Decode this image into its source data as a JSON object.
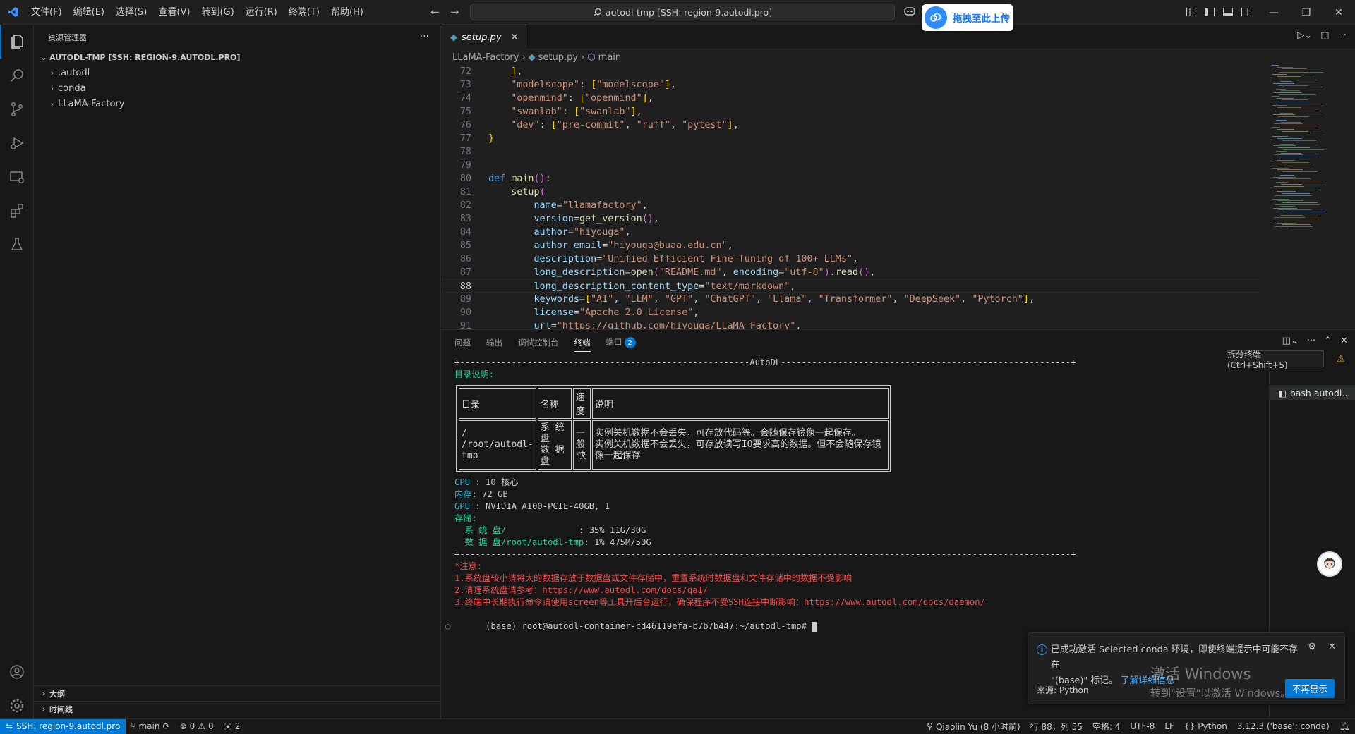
{
  "titlebar": {
    "menus": [
      "文件(F)",
      "编辑(E)",
      "选择(S)",
      "查看(V)",
      "转到(G)",
      "运行(R)",
      "终端(T)",
      "帮助(H)"
    ],
    "command_center": "autodl-tmp [SSH: region-9.autodl.pro]",
    "upload_label": "拖拽至此上传"
  },
  "sidebar": {
    "title": "资源管理器",
    "root": "AUTODL-TMP [SSH: REGION-9.AUTODL.PRO]",
    "items": [
      ".autodl",
      "conda",
      "LLaMA-Factory"
    ],
    "outline": "大纲",
    "timeline": "时间线"
  },
  "editor": {
    "tab": "setup.py",
    "breadcrumb": [
      "LLaMA-Factory",
      "setup.py",
      "main"
    ],
    "current_line": "88",
    "lines": [
      {
        "n": "72",
        "t": "    ],"
      },
      {
        "n": "73",
        "t": "    \"modelscope\": [\"modelscope\"],"
      },
      {
        "n": "74",
        "t": "    \"openmind\": [\"openmind\"],"
      },
      {
        "n": "75",
        "t": "    \"swanlab\": [\"swanlab\"],"
      },
      {
        "n": "76",
        "t": "    \"dev\": [\"pre-commit\", \"ruff\", \"pytest\"],"
      },
      {
        "n": "77",
        "t": "}"
      },
      {
        "n": "78",
        "t": ""
      },
      {
        "n": "79",
        "t": ""
      },
      {
        "n": "80",
        "t": "def main():"
      },
      {
        "n": "81",
        "t": "    setup("
      },
      {
        "n": "82",
        "t": "        name=\"llamafactory\","
      },
      {
        "n": "83",
        "t": "        version=get_version(),"
      },
      {
        "n": "84",
        "t": "        author=\"hiyouga\","
      },
      {
        "n": "85",
        "t": "        author_email=\"hiyouga@buaa.edu.cn\","
      },
      {
        "n": "86",
        "t": "        description=\"Unified Efficient Fine-Tuning of 100+ LLMs\","
      },
      {
        "n": "87",
        "t": "        long_description=open(\"README.md\", encoding=\"utf-8\").read(),"
      },
      {
        "n": "88",
        "t": "        long_description_content_type=\"text/markdown\","
      },
      {
        "n": "89",
        "t": "        keywords=[\"AI\", \"LLM\", \"GPT\", \"ChatGPT\", \"Llama\", \"Transformer\", \"DeepSeek\", \"Pytorch\"],"
      },
      {
        "n": "90",
        "t": "        license=\"Apache 2.0 License\","
      },
      {
        "n": "91",
        "t": "        url=\"https://github.com/hiyouga/LLaMA-Factory\","
      }
    ]
  },
  "panel": {
    "tabs": [
      "问题",
      "输出",
      "调试控制台",
      "终端",
      "端口"
    ],
    "ports_count": "2",
    "tooltip": "拆分终端 (Ctrl+Shift+5)",
    "terminal_entry": "bash autodl...",
    "terminal": {
      "rule_top": "+--------------------------------------------------------AutoDL--------------------------------------------------------+",
      "dir_heading": "目录说明:",
      "table": {
        "headers": [
          "目录",
          "名称",
          "速度",
          "说明"
        ],
        "col_dir": [
          "/",
          "/root/autodl-tmp"
        ],
        "col_name": [
          "系 统 盘",
          "数 据 盘"
        ],
        "col_speed": [
          "一般",
          "快"
        ],
        "col_desc": [
          "实例关机数据不会丢失，可存放代码等。会随保存镜像一起保存。",
          "实例关机数据不会丢失，可存放读写IO要求高的数据。但不会随保存镜像一起保存"
        ]
      },
      "cpu_label": "CPU",
      "cpu_value": " : 10 核心",
      "mem_label": "内存",
      "mem_value": ": 72 GB",
      "gpu_label": "GPU",
      "gpu_value": " : NVIDIA A100-PCIE-40GB, 1",
      "storage_label": "存储:",
      "sys_disk_label": "  系 统 盘/              ",
      "sys_disk_value": ": 35% 11G/30G",
      "data_disk_label": "  数 据 盘/root/autodl-tmp",
      "data_disk_value": ": 1% 475M/50G",
      "rule_bottom": "+----------------------------------------------------------------------------------------------------------------------+",
      "note_heading": "*注意:",
      "notes": [
        "1.系统盘较小请将大的数据存放于数据盘或文件存储中，重置系统时数据盘和文件存储中的数据不受影响",
        "2.清理系统盘请参考：https://www.autodl.com/docs/qa1/",
        "3.终端中长期执行命令请使用screen等工具开后台运行，确保程序不受SSH连接中断影响：https://www.autodl.com/docs/daemon/"
      ],
      "prompt": "(base) root@autodl-container-cd46119efa-b7b7b447:~/autodl-tmp# "
    }
  },
  "notification": {
    "message_1": "已成功激活 Selected conda 环境，即使终端提示中可能不存在",
    "message_2": "\"(base)\" 标记。",
    "link": "了解详细信息",
    "source": "来源: Python",
    "dismiss": "不再显示"
  },
  "watermark": {
    "line1": "激活 Windows",
    "line2": "转到\"设置\"以激活 Windows。"
  },
  "statusbar": {
    "remote": "SSH: region-9.autodl.pro",
    "branch": "main",
    "errors": "0",
    "warnings": "0",
    "ports": "2",
    "blame": "Qiaolin Yu (8 小时前)",
    "position": "行 88，列 55",
    "spaces": "空格: 4",
    "encoding": "UTF-8",
    "eol": "LF",
    "language": "Python",
    "interpreter": "3.12.3 ('base': conda)"
  },
  "colors": {
    "accent": "#0078d4",
    "background": "#1f1f1f",
    "terminal_green": "#23d18b",
    "terminal_red": "#f14c4c"
  }
}
